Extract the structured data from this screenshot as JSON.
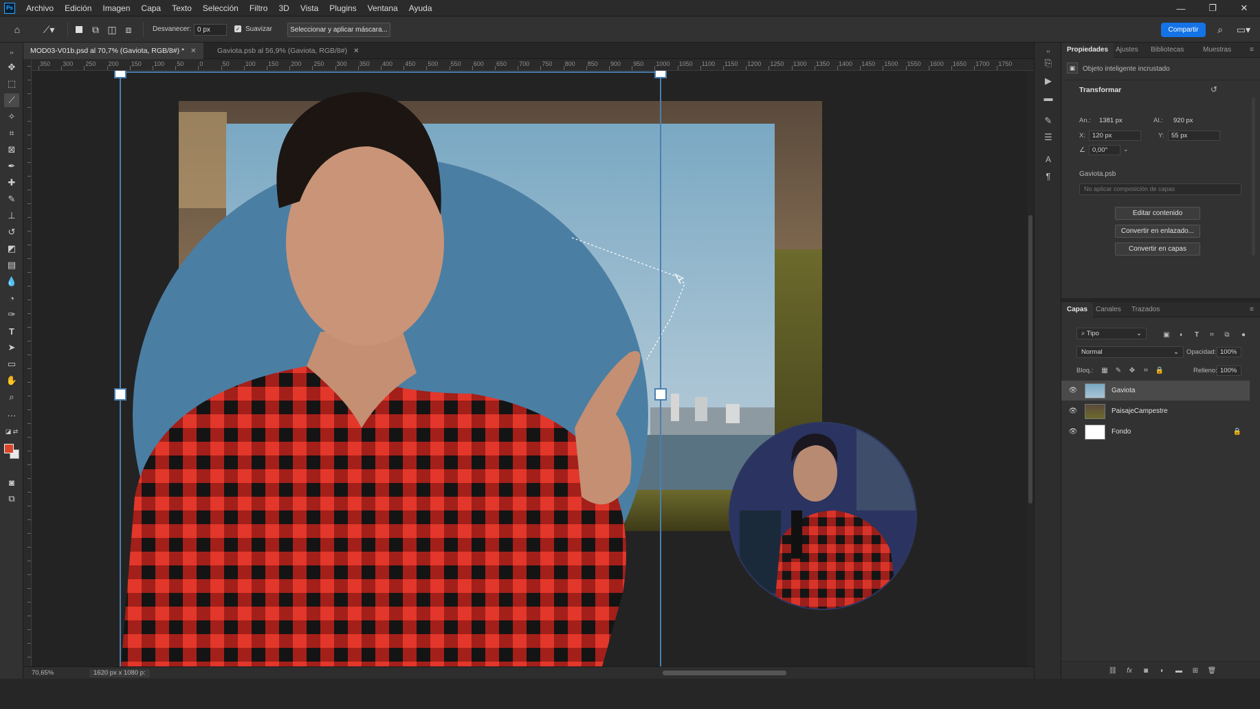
{
  "app": {
    "logo": "Ps"
  },
  "menu": [
    "Archivo",
    "Edición",
    "Imagen",
    "Capa",
    "Texto",
    "Selección",
    "Filtro",
    "3D",
    "Vista",
    "Plugins",
    "Ventana",
    "Ayuda"
  ],
  "window_controls": {
    "minimize": "—",
    "restore": "❐",
    "close": "✕"
  },
  "options": {
    "feather_label": "Desvanecer:",
    "feather_value": "0 px",
    "smooth_label": "Suavizar",
    "smooth_checked": true,
    "mask_button": "Seleccionar y aplicar máscara...",
    "share_button": "Compartir"
  },
  "tabs": [
    {
      "label": "MOD03-V01b.psd al 70,7% (Gaviota, RGB/8#) *",
      "active": true
    },
    {
      "label": "Gaviota.psb al 56,9% (Gaviota, RGB/8#)",
      "active": false
    }
  ],
  "ruler_h": [
    "350",
    "300",
    "250",
    "200",
    "150",
    "100",
    "50",
    "0",
    "50",
    "100",
    "150",
    "200",
    "250",
    "300",
    "350",
    "400",
    "450",
    "500",
    "550",
    "600",
    "650",
    "700",
    "750",
    "800",
    "850",
    "900",
    "950",
    "1000",
    "1050",
    "1100",
    "1150",
    "1200",
    "1250",
    "1300",
    "1350",
    "1400",
    "1450",
    "1500",
    "1550",
    "1600",
    "1650",
    "1700",
    "1750"
  ],
  "status": {
    "zoom": "70,65%",
    "doc_size": "1620 px x 1080 p:"
  },
  "properties": {
    "tabs": [
      "Propiedades",
      "Ajustes",
      "Bibliotecas",
      "Muestras"
    ],
    "object_type": "Objeto inteligente incrustado",
    "transform_title": "Transformar",
    "width_label": "An.:",
    "width_value": "1381 px",
    "height_label": "Al.:",
    "height_value": "920 px",
    "x_label": "X:",
    "x_value": "120 px",
    "y_label": "Y:",
    "y_value": "55 px",
    "angle_value": "0,00°",
    "file_name": "Gaviota.psb",
    "composition_placeholder": "No aplicar composición de capas",
    "buttons": [
      "Editar contenido",
      "Convertir en enlazado...",
      "Convertir en capas"
    ]
  },
  "layers": {
    "tabs": [
      "Capas",
      "Canales",
      "Trazados"
    ],
    "filter_kind": "Tipo",
    "blend_mode": "Normal",
    "opacity_label": "Opacidad:",
    "opacity_value": "100%",
    "lock_label": "Bloq.:",
    "fill_label": "Relleno:",
    "fill_value": "100%",
    "items": [
      {
        "name": "Gaviota",
        "selected": true,
        "locked": false
      },
      {
        "name": "PaisajeCampestre",
        "selected": false,
        "locked": false
      },
      {
        "name": "Fondo",
        "selected": false,
        "locked": true
      }
    ]
  },
  "colors": {
    "foreground": "#d9462b",
    "background": "#e8e8e8",
    "accent": "#1473e6",
    "transform_frame": "#4a7fae"
  }
}
